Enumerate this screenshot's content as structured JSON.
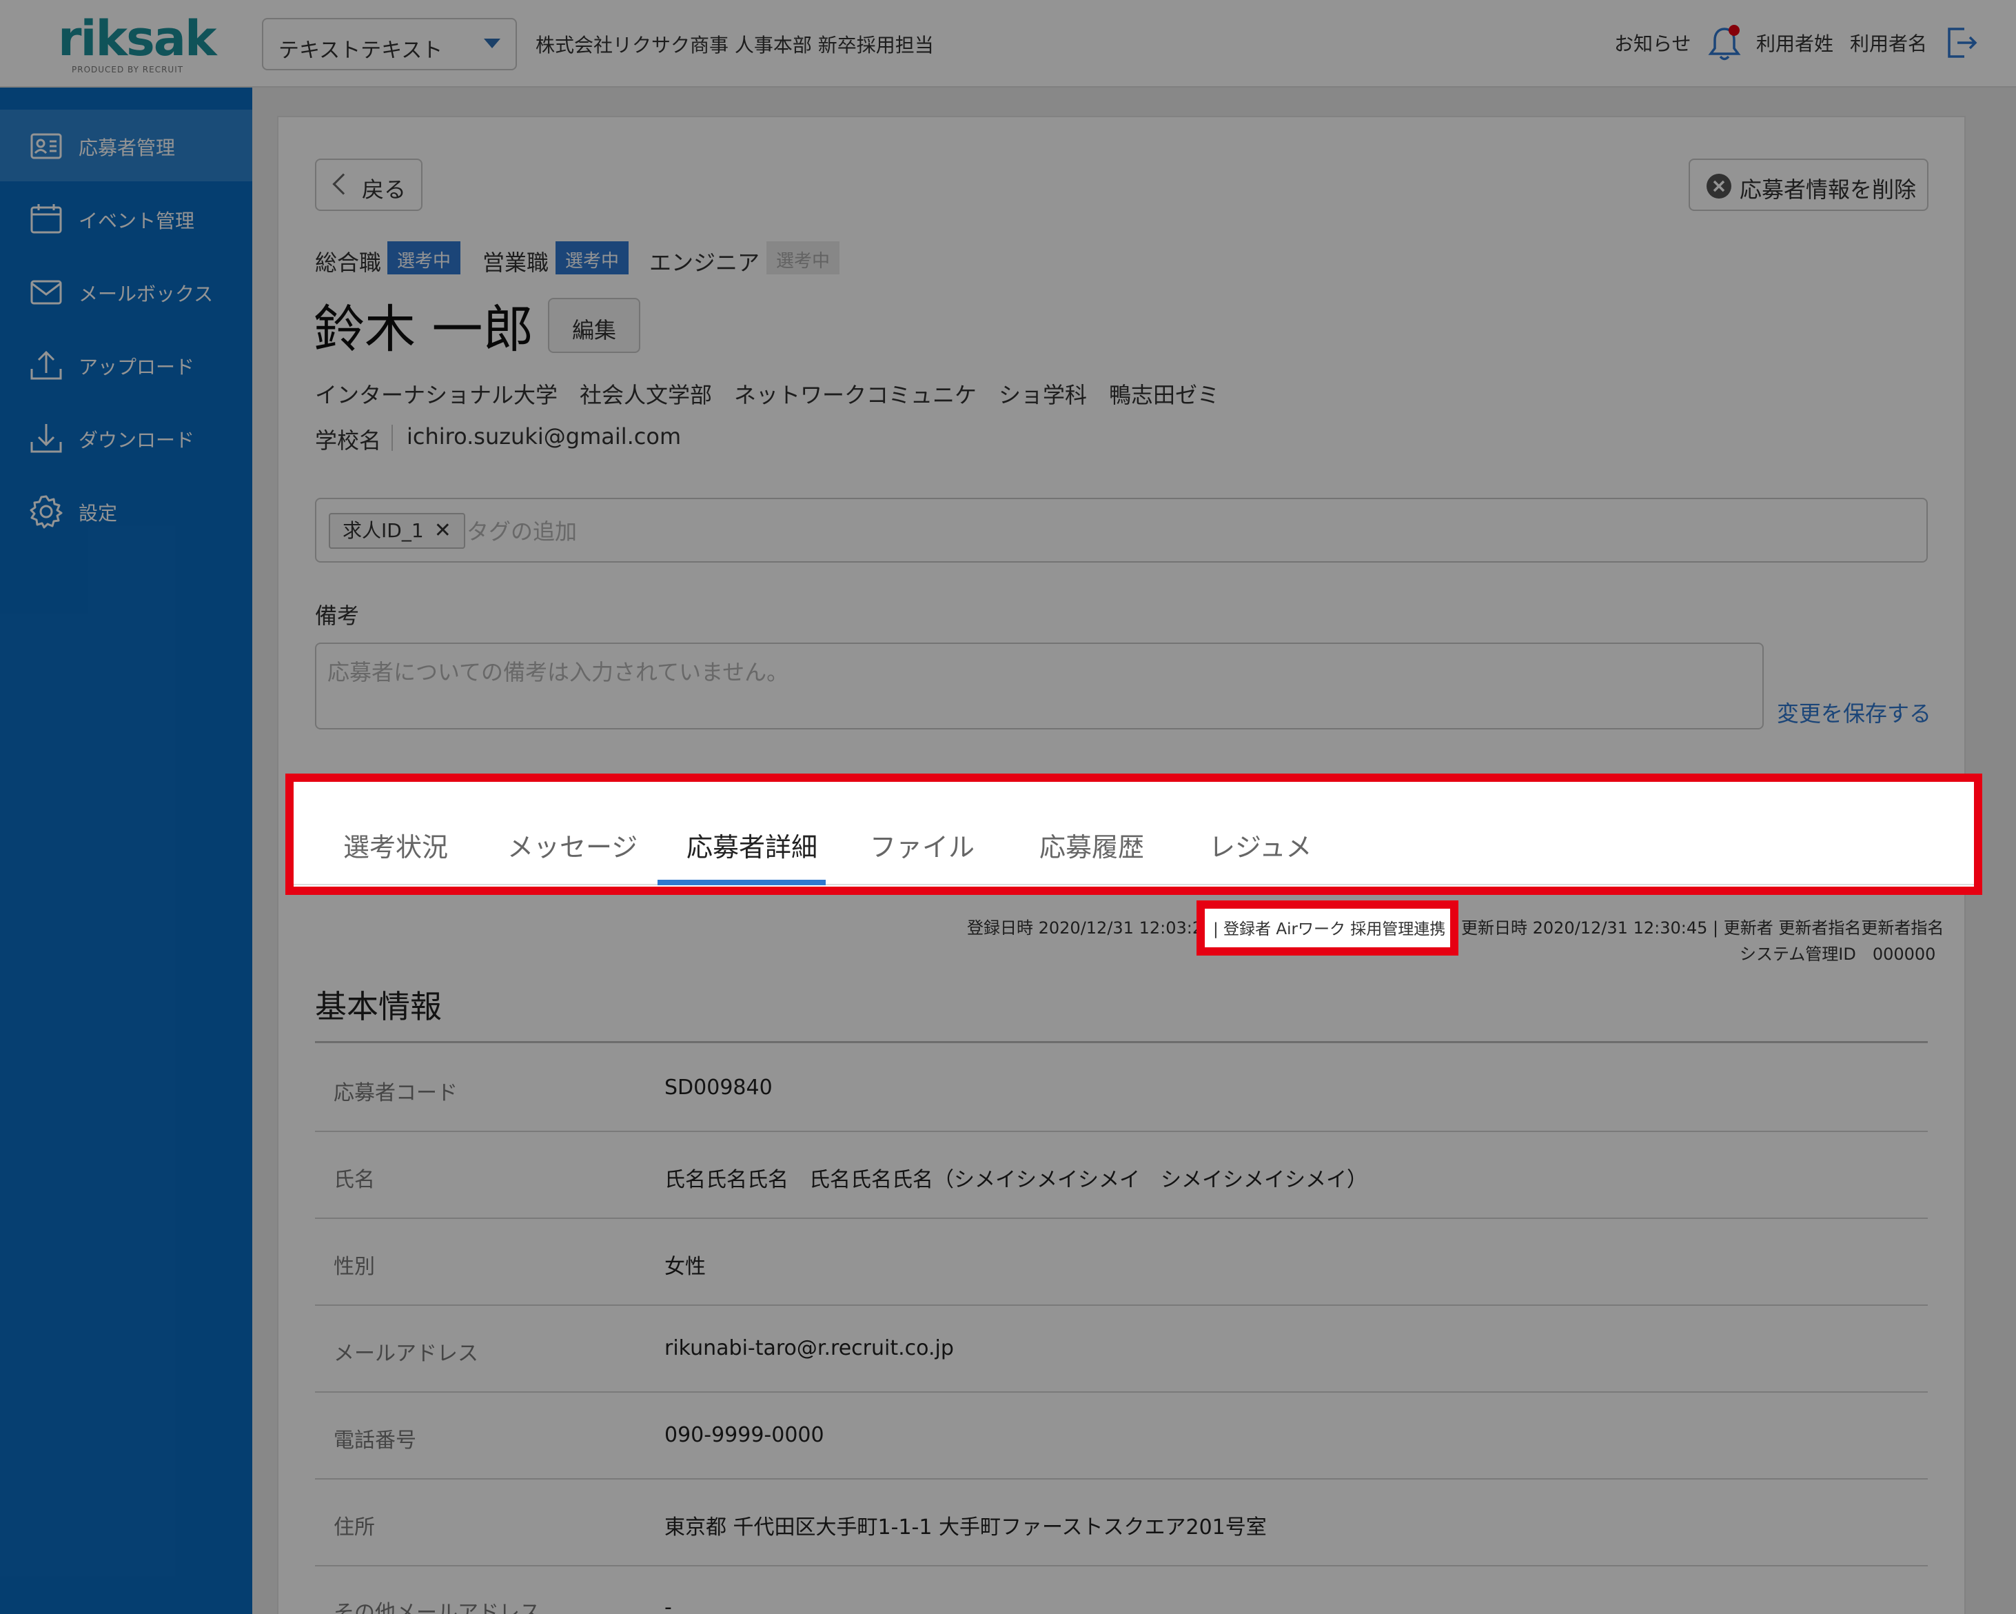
{
  "header": {
    "logo_text": "riksak",
    "logo_sub": "PRODUCED BY RECRUIT",
    "org_select": "テキストテキスト",
    "company": "株式会社リクサク商事 人事本部 新卒採用担当",
    "notifications": "お知らせ",
    "user_last": "利用者姓",
    "user_first": "利用者名"
  },
  "sidebar": {
    "items": [
      {
        "label": "応募者管理",
        "icon": "applicant-card-icon"
      },
      {
        "label": "イベント管理",
        "icon": "calendar-icon"
      },
      {
        "label": "メールボックス",
        "icon": "mail-icon"
      },
      {
        "label": "アップロード",
        "icon": "upload-icon"
      },
      {
        "label": "ダウンロード",
        "icon": "download-icon"
      },
      {
        "label": "設定",
        "icon": "gear-icon"
      }
    ]
  },
  "toolbar": {
    "back": "戻る",
    "delete": "応募者情報を削除"
  },
  "applicant": {
    "jobs": [
      {
        "name": "総合職",
        "status": "選考中"
      },
      {
        "name": "営業職",
        "status": "選考中"
      },
      {
        "name": "エンジニア",
        "status": "選考中"
      }
    ],
    "name": "鈴木 一郎",
    "edit": "編集",
    "school_line": "インターナショナル大学　社会人文学部　ネットワークコミュニケ　ショ学科　鴨志田ゼミ",
    "school_label": "学校名",
    "email": "ichiro.suzuki@gmail.com"
  },
  "tags": {
    "chip": "求人ID_1",
    "chip_remove": "✕",
    "placeholder": "タグの追加"
  },
  "memo": {
    "label": "備考",
    "placeholder": "応募者についての備考は入力されていません。",
    "save": "変更を保存する"
  },
  "tabs": [
    "選考状況",
    "メッセージ",
    "応募者詳細",
    "ファイル",
    "応募履歴",
    "レジュメ"
  ],
  "meta": {
    "registered": "登録日時 2020/12/31 12:03:2",
    "registrant": "| 登録者 Airワーク 採用管理連携",
    "updated": "更新日時 2020/12/31 12:30:45 | 更新者 更新者指名更新者指名",
    "system_id": "システム管理ID　000000"
  },
  "basic_info": {
    "title": "基本情報",
    "rows": [
      {
        "label": "応募者コード",
        "value": "SD009840"
      },
      {
        "label": "氏名",
        "value": "氏名氏名氏名　氏名氏名氏名（シメイシメイシメイ　シメイシメイシメイ）"
      },
      {
        "label": "性別",
        "value": "女性"
      },
      {
        "label": "メールアドレス",
        "value": "rikunabi-taro@r.recruit.co.jp"
      },
      {
        "label": "電話番号",
        "value": "090-9999-0000"
      },
      {
        "label": "住所",
        "value": "東京都 千代田区大手町1-1-1 大手町ファーストスクエア201号室"
      },
      {
        "label": "その他メールアドレス",
        "value": "-"
      }
    ]
  },
  "colors": {
    "sidebar": "#0a6cc2",
    "accent": "#2f78cf",
    "highlight": "#e60012",
    "logo": "#1d8f99"
  }
}
